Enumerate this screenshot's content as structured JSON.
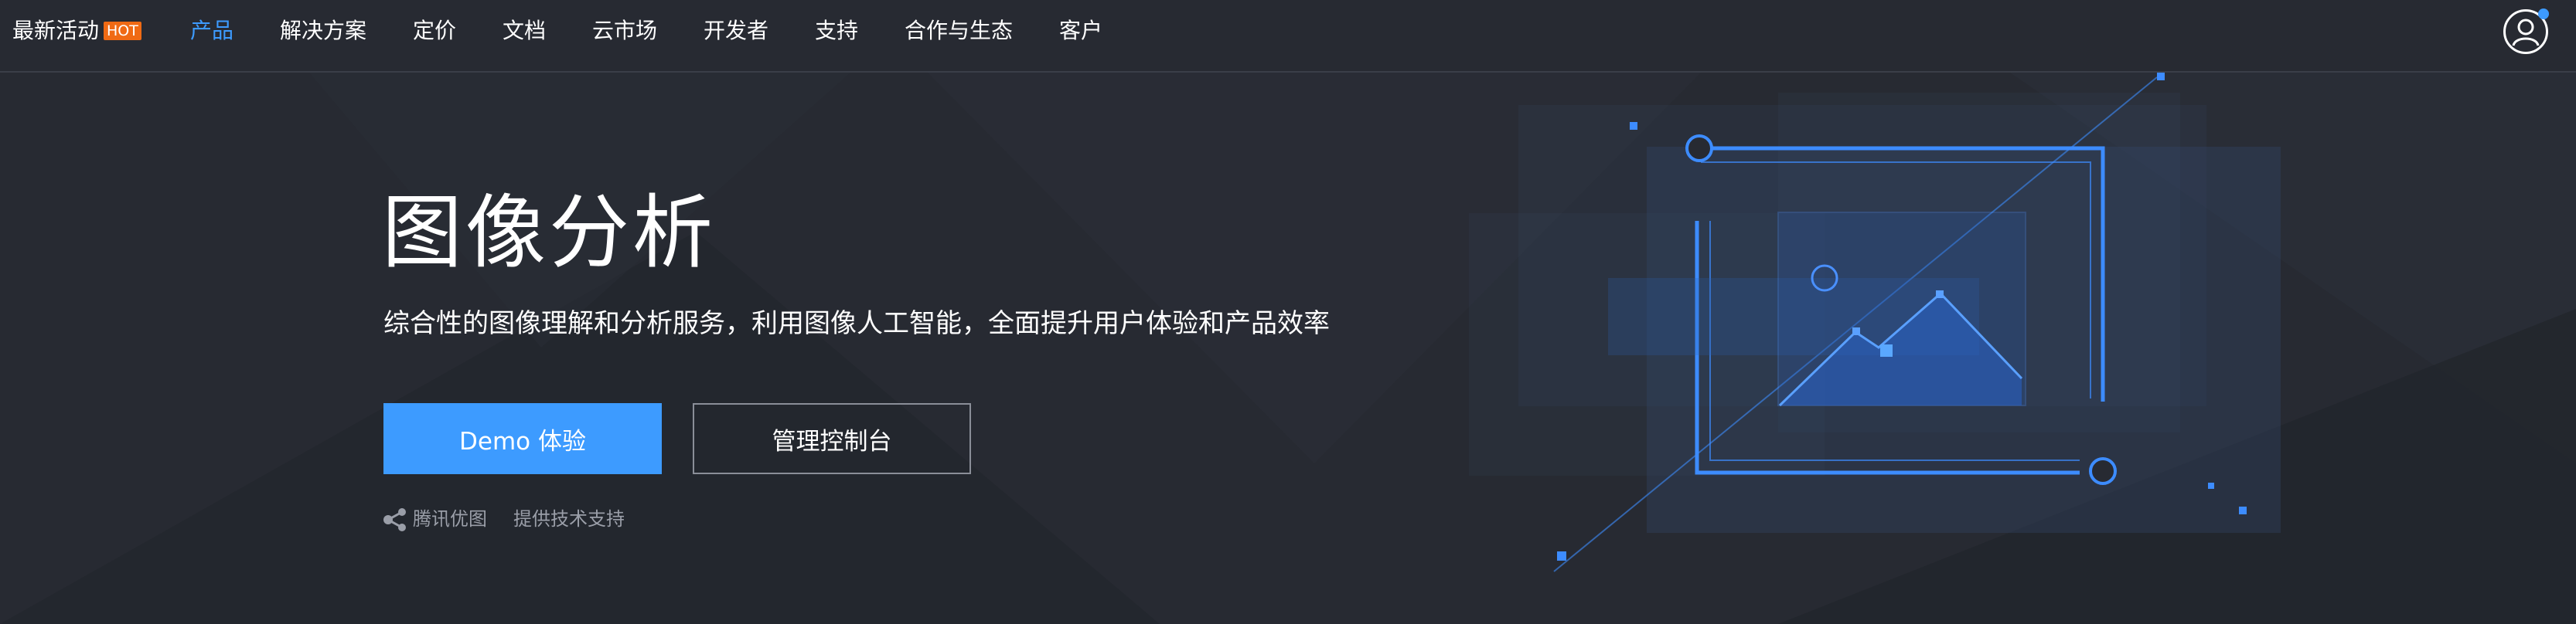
{
  "nav": {
    "items": [
      {
        "label": "最新活动",
        "badge": "HOT"
      },
      {
        "label": "产品"
      },
      {
        "label": "解决方案"
      },
      {
        "label": "定价"
      },
      {
        "label": "文档"
      },
      {
        "label": "云市场"
      },
      {
        "label": "开发者"
      },
      {
        "label": "支持"
      },
      {
        "label": "合作与生态"
      },
      {
        "label": "客户"
      }
    ],
    "active_index": 1
  },
  "hero": {
    "title": "图像分析",
    "subtitle": "综合性的图像理解和分析服务，利用图像人工智能，全面提升用户体验和产品效率",
    "primary_button": "Demo 体验",
    "secondary_button": "管理控制台",
    "support": {
      "brand": "腾讯优图",
      "text": "提供技术支持"
    }
  },
  "icons": {
    "user": "user-avatar-icon",
    "brand": "youtu-logo-icon",
    "illustration": "image-analysis-illustration"
  },
  "colors": {
    "background": "#272a32",
    "accent": "#3d9bff",
    "hot_badge": "#f06a14",
    "muted_text": "#9a9ea8"
  }
}
